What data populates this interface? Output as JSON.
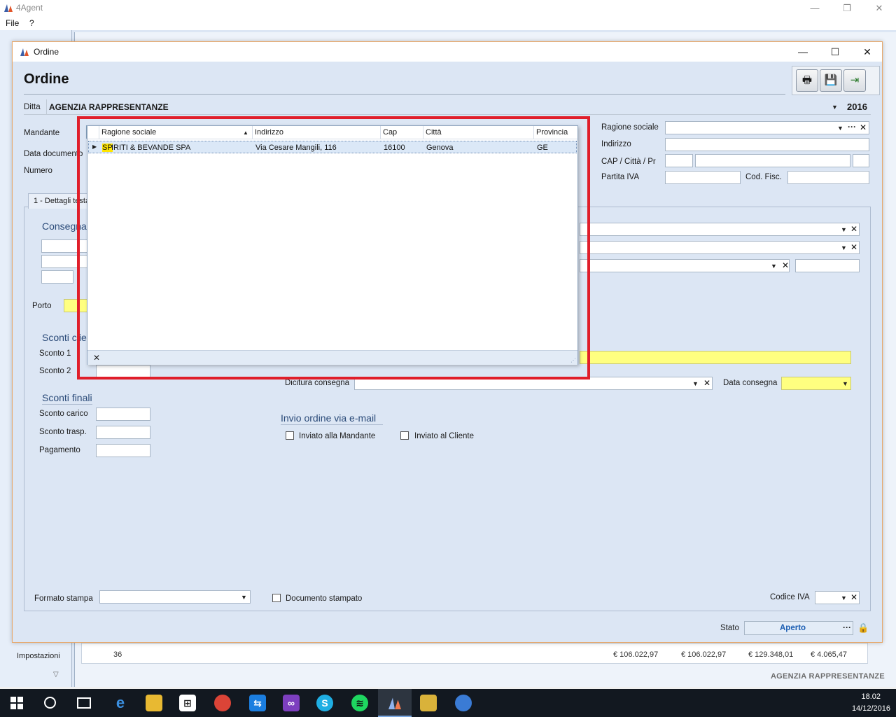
{
  "app": {
    "title": "4Agent",
    "menu": [
      "File",
      "?"
    ]
  },
  "background": {
    "nav_item": "Impostazioni",
    "table_row": {
      "count": "36",
      "v1": "€ 106.022,97",
      "v2": "€ 106.022,97",
      "v3": "€ 129.348,01",
      "v4": "€ 4.065,47"
    },
    "company": "AGENZIA RAPPRESENTANZE"
  },
  "ordine": {
    "window_title": "Ordine",
    "heading": "Ordine",
    "ditta_label": "Ditta",
    "ditta_value": "AGENZIA RAPPRESENTANZE",
    "year": "2016",
    "mandante_label": "Mandante",
    "mandante_value": "SPIRITI & BEVANDE SPA",
    "mandante_typed": "SP",
    "data_documento_label": "Data documento",
    "numero_label": "Numero",
    "ragione_sociale_label": "Ragione sociale",
    "indirizzo_label": "Indirizzo",
    "cap_label": "CAP / Città / Pr",
    "partita_iva_label": "Partita IVA",
    "cod_fisc_label": "Cod. Fisc.",
    "tab_label": "1 - Dettagli testata",
    "consegna_section": "Consegna",
    "porto_label": "Porto",
    "sconti_section": "Sconti cliente",
    "sconto1_label": "Sconto 1",
    "sconto2_label": "Sconto 2",
    "sconti_finali_section": "Sconti finali",
    "sconto_carico_label": "Sconto carico",
    "sconto_trasp_label": "Sconto trasp.",
    "pagamento_label": "Pagamento",
    "dicitura_label": "Dicitura consegna",
    "data_consegna_label": "Data consegna",
    "email_section": "Invio ordine via e-mail",
    "inviato_mandante": "Inviato alla Mandante",
    "inviato_cliente": "Inviato al Cliente",
    "formato_stampa_label": "Formato stampa",
    "documento_stampato": "Documento stampato",
    "codice_iva_label": "Codice IVA",
    "stato_label": "Stato",
    "stato_value": "Aperto"
  },
  "dropdown": {
    "columns": [
      "Ragione sociale",
      "Indirizzo",
      "Cap",
      "Città",
      "Provincia"
    ],
    "rows": [
      {
        "highlight": "SP",
        "ragione_rest": "IRITI & BEVANDE SPA",
        "indirizzo": "Via Cesare Mangili, 116",
        "cap": "16100",
        "citta": "Genova",
        "provincia": "GE"
      }
    ]
  },
  "taskbar": {
    "time": "18.02",
    "date": "14/12/2016"
  },
  "colors": {
    "highlight_box": "#e01e2a",
    "required_field": "#ffff80",
    "accent_blue": "#2a4a78"
  }
}
